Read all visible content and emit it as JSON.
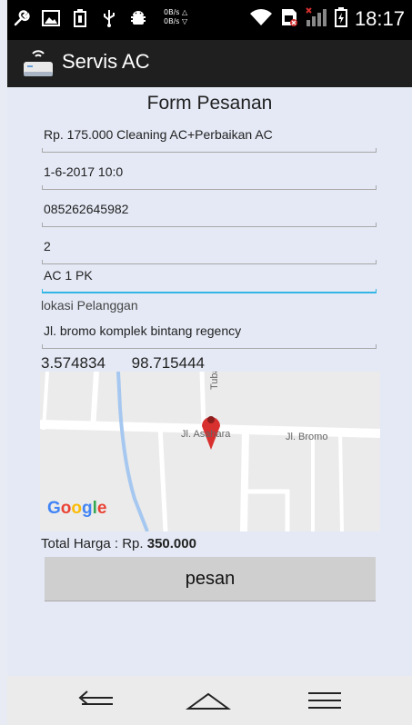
{
  "status_bar": {
    "net_up": "0B/s △",
    "net_down": "0B/s ▽",
    "time": "18:17",
    "left_icons": [
      "wrench-icon",
      "image-icon",
      "battery-saver-icon",
      "usb-icon",
      "android-debug-icon"
    ],
    "right_icons": [
      "wifi-icon",
      "sim-blocked-icon",
      "signal-icon",
      "battery-charging-icon"
    ]
  },
  "app_bar": {
    "title": "Servis AC",
    "logo_icon": "air-conditioner-icon"
  },
  "form": {
    "title": "Form Pesanan",
    "fields": [
      {
        "value": "Rp. 175.000 Cleaning AC+Perbaikan AC"
      },
      {
        "value": "1-6-2017 10:0"
      },
      {
        "value": "085262645982"
      },
      {
        "value": "2"
      },
      {
        "value": "AC 1 PK"
      }
    ],
    "location_label": "lokasi Pelanggan",
    "address": "Jl. bromo komplek bintang regency",
    "latitude": "3.574834",
    "longitude": "98.715444",
    "map": {
      "streets": [
        "Tuba",
        "Jl. Asahara",
        "Jl. Bromo"
      ],
      "attribution": "Google",
      "marker_icon": "map-pin-icon"
    },
    "total_label": "Total Harga : Rp.",
    "total_value": "350.000",
    "submit_label": "pesan"
  },
  "nav_bar": {
    "back_icon": "back-icon",
    "home_icon": "home-icon",
    "menu_icon": "menu-icon"
  },
  "colors": {
    "status_bar": "#000000",
    "app_bar": "#1f1f1f",
    "background": "#e4e9f5",
    "focus_line": "#33b5e5",
    "button": "#cfcfcf",
    "marker": "#d8302f"
  }
}
